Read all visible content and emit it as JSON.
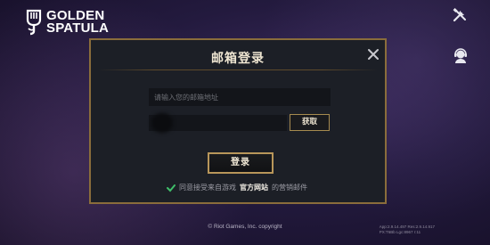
{
  "brand": {
    "line1": "GOLDEN",
    "line2": "SPATULA",
    "icon": "spatula-logo-icon"
  },
  "header": {
    "tools_icon": "tools-icon",
    "coach_icon": "coach-avatar-icon"
  },
  "modal": {
    "title": "邮箱登录",
    "close_icon": "close-icon",
    "email_placeholder": "请输入您的邮箱地址",
    "code_value": "",
    "fetch_label": "获取",
    "login_label": "登录",
    "consent": {
      "checked": true,
      "prefix": "同意接受来自游戏",
      "link": "官方网站",
      "suffix": "的营销邮件"
    }
  },
  "footer": {
    "copyright": "© Riot Games, Inc. copyright",
    "version_line1": "App:2.9.14.497 Res:2.9.14.917",
    "version_line2": "PX:T6Bb Lgc:8967 r:11"
  },
  "colors": {
    "accent": "#b8965a",
    "check": "#3fbf6a",
    "modal_bg": "#1c1f26"
  }
}
